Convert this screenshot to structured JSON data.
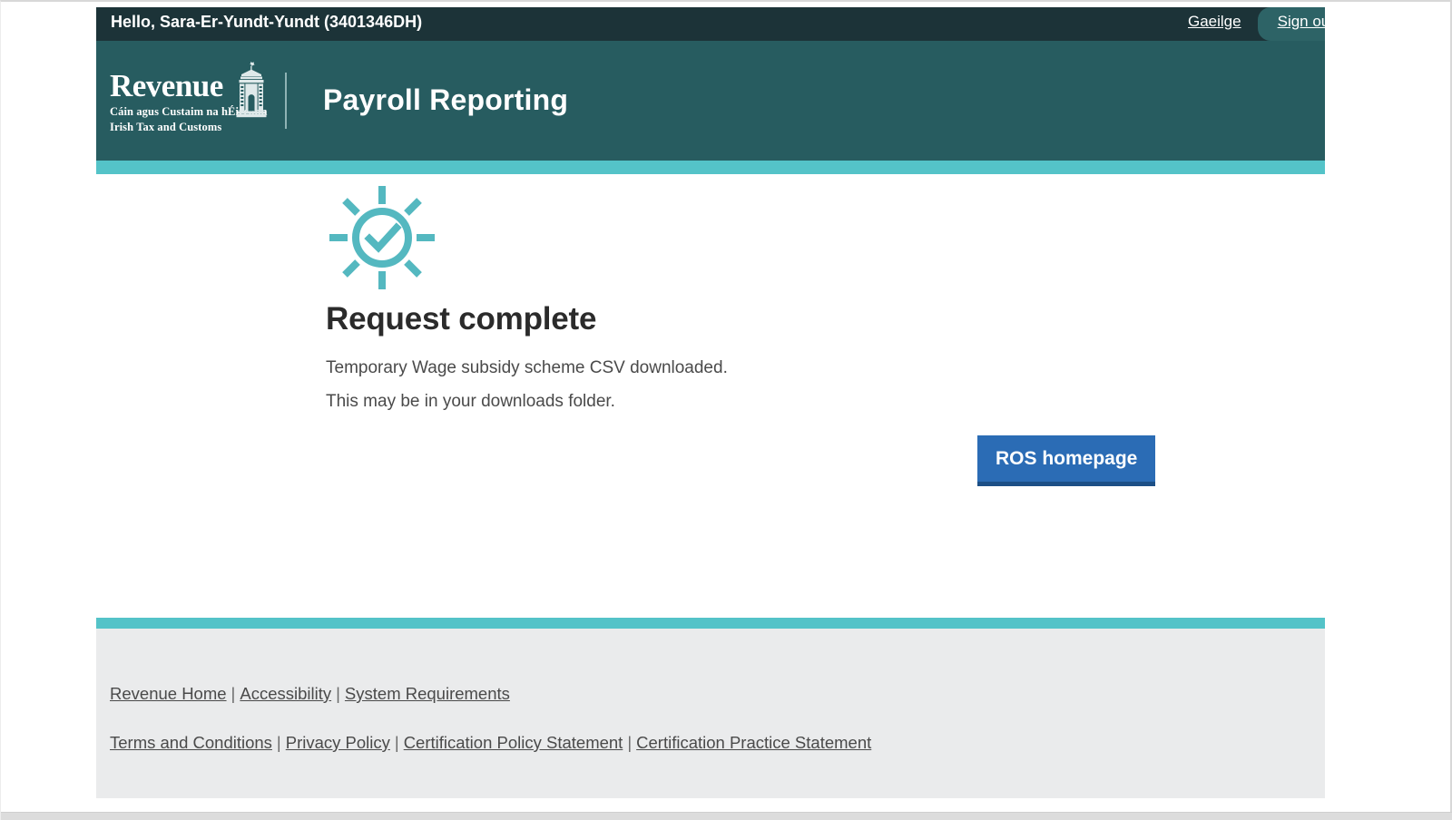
{
  "topbar": {
    "greeting": "Hello, Sara-Er-Yundt-Yundt (3401346DH)",
    "language_link": "Gaeilge",
    "signout_link": "Sign out"
  },
  "header": {
    "logo_word": "Revenue",
    "logo_sub_irish": "Cáin agus Custaim na hÉireann",
    "logo_sub_english": "Irish Tax and Customs",
    "logo_emblem_icon": "custom-house-arch-icon",
    "title": "Payroll Reporting",
    "teal": "#275c60",
    "topbar_dark": "#1c3338",
    "accent": "#54c3c8"
  },
  "main": {
    "status_icon": "success-sunburst-check-icon",
    "heading": "Request complete",
    "line1": "Temporary Wage subsidy scheme CSV downloaded.",
    "line2": "This may be in your downloads folder.",
    "primary_button": "ROS homepage",
    "primary_button_color": "#2b6cb5"
  },
  "footer": {
    "row1": [
      "Revenue Home",
      "Accessibility",
      "System Requirements"
    ],
    "row2": [
      "Terms and Conditions",
      "Privacy Policy",
      "Certification Policy Statement",
      "Certification Practice Statement"
    ],
    "separator": "|",
    "background": "#eaebec"
  }
}
